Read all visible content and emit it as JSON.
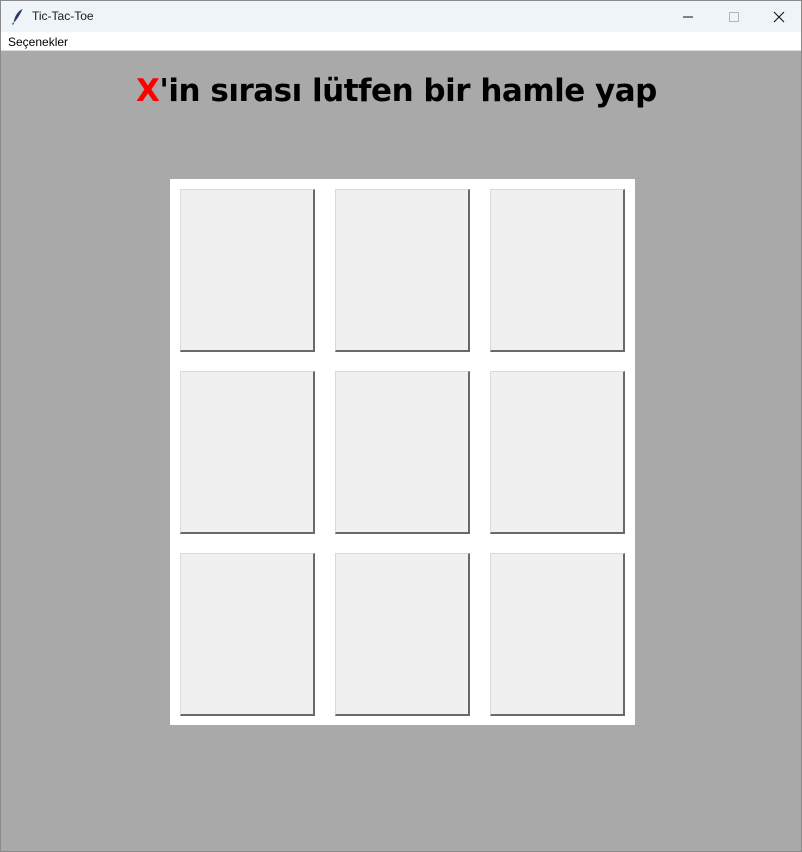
{
  "window": {
    "title": "Tic-Tac-Toe",
    "icon": "feather-icon"
  },
  "menu": {
    "items": [
      "Seçenekler"
    ]
  },
  "status": {
    "player": "X",
    "message": "'in sırası lütfen bir hamle yap",
    "player_color": "#ff0000"
  },
  "board": {
    "cells": [
      "",
      "",
      "",
      "",
      "",
      "",
      "",
      "",
      ""
    ]
  },
  "colors": {
    "background": "#a9a9a9",
    "board": "#ffffff",
    "cell": "#f0f0f0"
  }
}
